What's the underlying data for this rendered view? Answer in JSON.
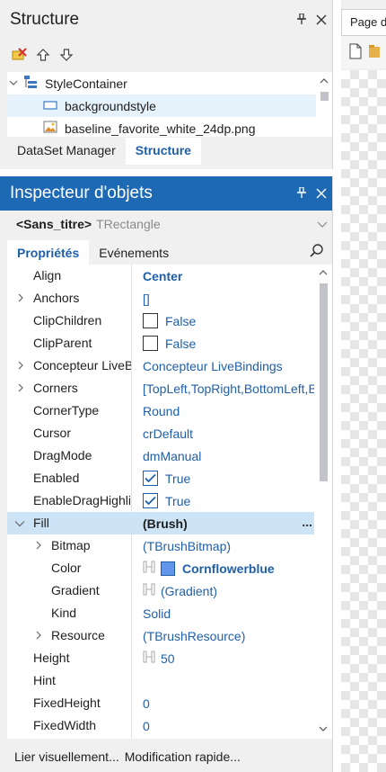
{
  "structure_panel": {
    "title": "Structure",
    "pin_glyph": "❘",
    "close_glyph": "✕",
    "toolbar": [
      "delete-icon",
      "move-up-icon",
      "move-down-icon"
    ],
    "tree": [
      {
        "label": "StyleContainer",
        "expander": "∨",
        "icon": "style-container-icon",
        "indent": 0
      },
      {
        "label": "backgroundstyle",
        "icon": "rectangle-icon",
        "indent": 1,
        "selected": true
      },
      {
        "label": "baseline_favorite_white_24dp.png",
        "icon": "image-icon",
        "indent": 1
      }
    ],
    "tabs": [
      {
        "label": "DataSet Manager",
        "active": false
      },
      {
        "label": "Structure",
        "active": true
      }
    ]
  },
  "page_strip": {
    "tab_label": "Page d"
  },
  "inspector": {
    "title": "Inspecteur d'objets",
    "pin_glyph": "❘",
    "close_glyph": "✕",
    "object_name": "<Sans_titre>",
    "object_type": "TRectangle",
    "tabs": [
      {
        "label": "Propriétés",
        "active": true
      },
      {
        "label": "Evénements",
        "active": false
      }
    ],
    "properties": [
      {
        "name": "Align",
        "value": "Center",
        "style": "bold"
      },
      {
        "name": "Anchors",
        "value": "[]",
        "expander": true
      },
      {
        "name": "ClipChildren",
        "value": "False",
        "checkbox": false
      },
      {
        "name": "ClipParent",
        "value": "False",
        "checkbox": false
      },
      {
        "name": "Concepteur LiveBindings",
        "value": "Concepteur LiveBindings",
        "expander": true
      },
      {
        "name": "Corners",
        "value": "[TopLeft,TopRight,BottomLeft,BottomRight]",
        "expander": true
      },
      {
        "name": "CornerType",
        "value": "Round"
      },
      {
        "name": "Cursor",
        "value": "crDefault"
      },
      {
        "name": "DragMode",
        "value": "dmManual"
      },
      {
        "name": "Enabled",
        "value": "True",
        "checkbox": true
      },
      {
        "name": "EnableDragHighlight",
        "value": "True",
        "checkbox": true
      },
      {
        "name": "Fill",
        "value": "(Brush)",
        "expander": true,
        "expanded": true,
        "selected": true,
        "style": "dark",
        "ellipsis": "..."
      },
      {
        "name": "Bitmap",
        "value": "(TBrushBitmap)",
        "expander": true,
        "child": true
      },
      {
        "name": "Color",
        "value": "Cornflowerblue",
        "child": true,
        "swatch": "#6495ED",
        "style": "bold",
        "link": true
      },
      {
        "name": "Gradient",
        "value": "(Gradient)",
        "child": true,
        "link": true
      },
      {
        "name": "Kind",
        "value": "Solid",
        "child": true
      },
      {
        "name": "Resource",
        "value": "(TBrushResource)",
        "expander": true,
        "child": true
      },
      {
        "name": "Height",
        "value": "50",
        "link": true
      },
      {
        "name": "Hint",
        "value": ""
      },
      {
        "name": "FixedHeight",
        "value": "0"
      },
      {
        "name": "FixedWidth",
        "value": "0"
      }
    ],
    "footer": {
      "link1": "Lier visuellement...",
      "link2": "Modification rapide..."
    }
  },
  "colors": {
    "accent": "#1E69B4",
    "value_text": "#1F5FA8",
    "selection": "#CDE4F7",
    "cornflowerblue": "#6495ED"
  }
}
